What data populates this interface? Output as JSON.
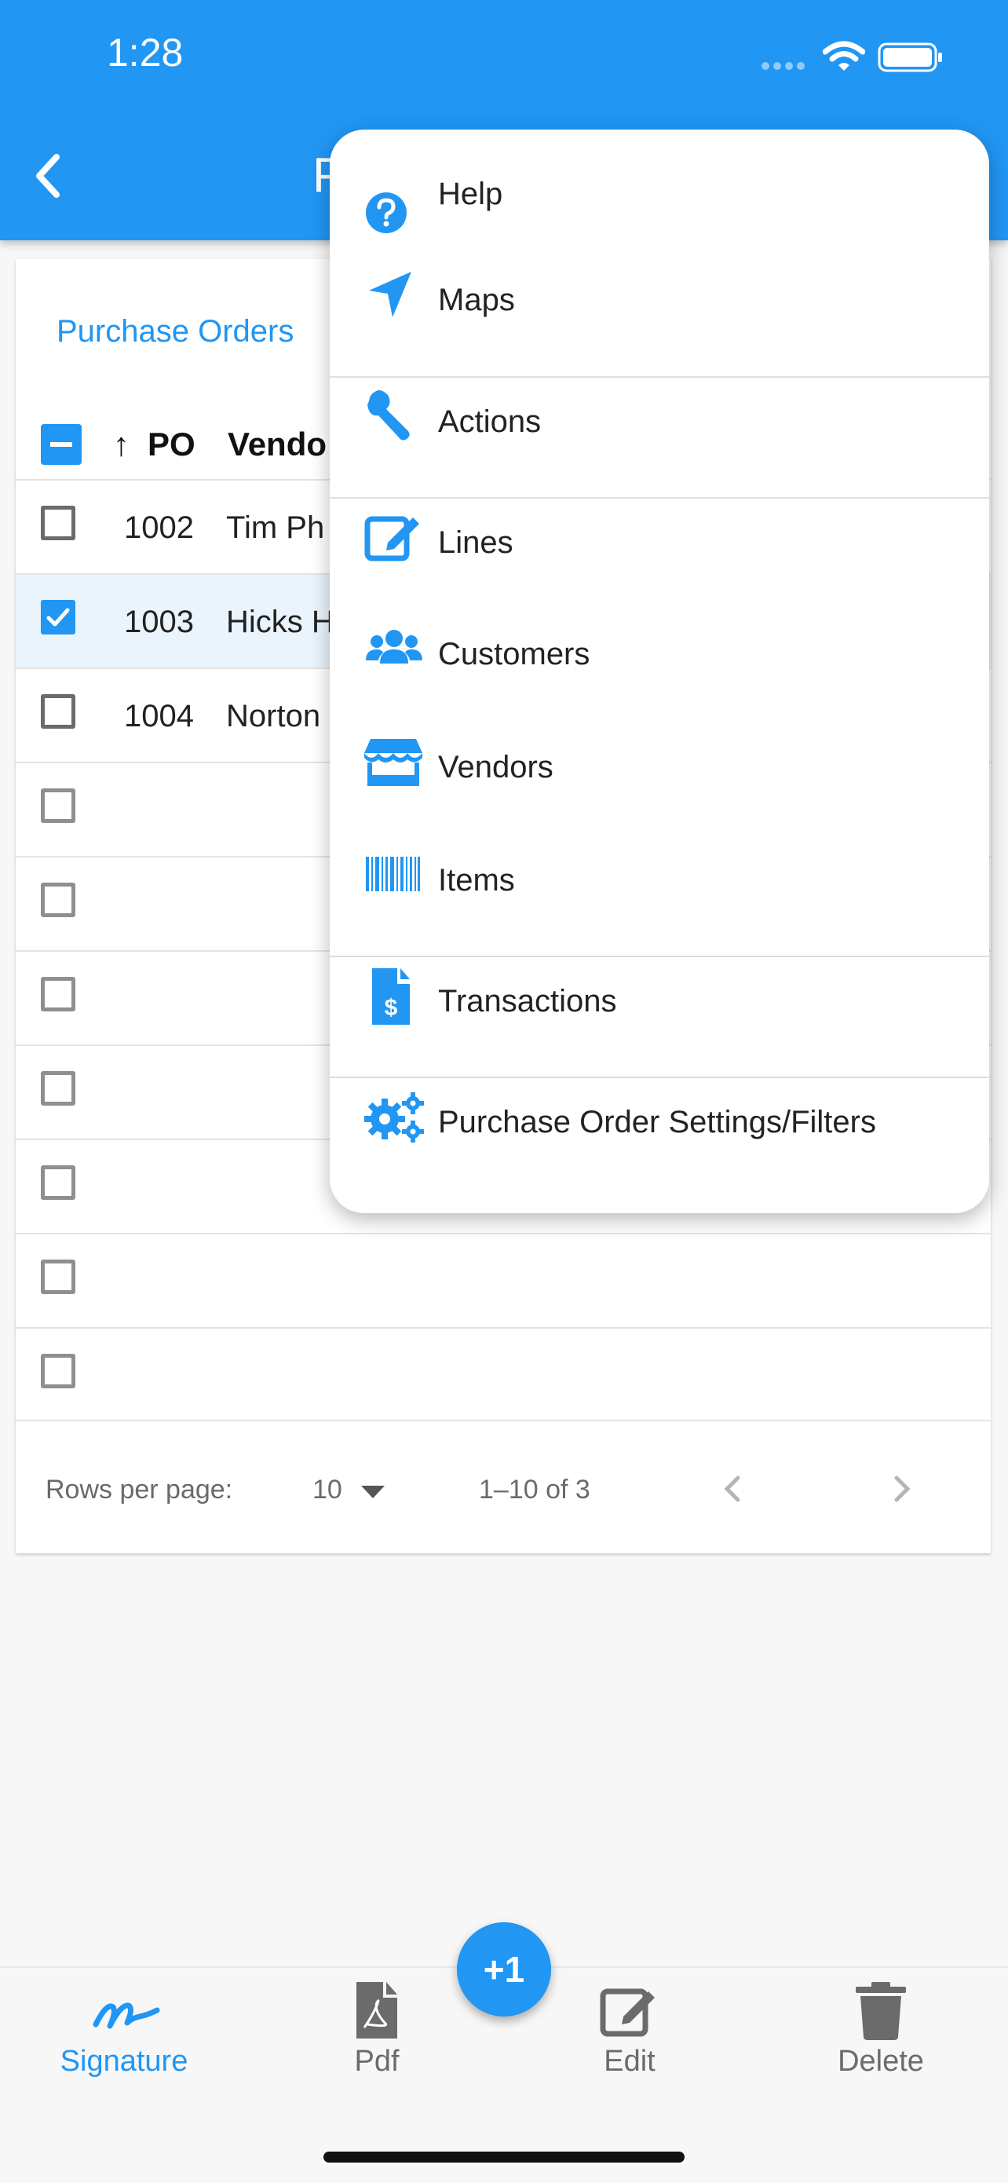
{
  "status_bar": {
    "time": "1:28"
  },
  "app_bar": {
    "title_fragment": "P"
  },
  "card": {
    "title": "Purchase Orders"
  },
  "table": {
    "header": {
      "sort_arrow": "↑",
      "po": "PO",
      "vendor": "Vendo"
    },
    "rows": [
      {
        "po": "1002",
        "vendor": "Tim Ph",
        "checked": false
      },
      {
        "po": "1003",
        "vendor": "Hicks H",
        "checked": true
      },
      {
        "po": "1004",
        "vendor": "Norton",
        "checked": false
      },
      {
        "po": "",
        "vendor": "",
        "checked": false
      },
      {
        "po": "",
        "vendor": "",
        "checked": false
      },
      {
        "po": "",
        "vendor": "",
        "checked": false
      },
      {
        "po": "",
        "vendor": "",
        "checked": false
      },
      {
        "po": "",
        "vendor": "",
        "checked": false
      },
      {
        "po": "",
        "vendor": "",
        "checked": false
      },
      {
        "po": "",
        "vendor": "",
        "checked": false
      }
    ],
    "footer": {
      "rows_per_page_label": "Rows per page:",
      "rows_per_page_value": "10",
      "range": "1–10 of 3"
    }
  },
  "menu": {
    "items": [
      {
        "label": "Help",
        "icon": "help-icon"
      },
      {
        "label": "Maps",
        "icon": "navigation-arrow-icon"
      },
      {
        "label": "Actions",
        "icon": "wrench-icon"
      },
      {
        "label": "Lines",
        "icon": "edit-icon"
      },
      {
        "label": "Customers",
        "icon": "users-icon"
      },
      {
        "label": "Vendors",
        "icon": "store-icon"
      },
      {
        "label": "Items",
        "icon": "barcode-icon"
      },
      {
        "label": "Transactions",
        "icon": "invoice-icon"
      },
      {
        "label": "Purchase Order Settings/Filters",
        "icon": "gears-icon"
      }
    ]
  },
  "bottom_nav": {
    "items": [
      {
        "label": "Signature",
        "icon": "signature-icon",
        "active": true
      },
      {
        "label": "Pdf",
        "icon": "pdf-icon",
        "active": false
      },
      {
        "label": "Edit",
        "icon": "edit-icon",
        "active": false
      },
      {
        "label": "Delete",
        "icon": "trash-icon",
        "active": false
      }
    ],
    "fab_label": "+1"
  },
  "colors": {
    "primary": "#2196f3",
    "selected_row": "#eaf4fd"
  }
}
